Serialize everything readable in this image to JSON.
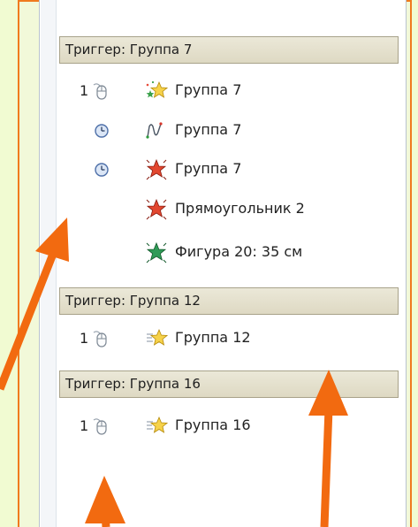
{
  "panel": {
    "triggers": [
      {
        "header": "Триггер: Группа 7",
        "items": [
          {
            "num": "1",
            "start": "mouse-click-icon",
            "effect": "entrance-effect-icon",
            "label": "Группа 7"
          },
          {
            "num": "",
            "start": "clock-icon",
            "effect": "motion-path-icon",
            "label": "Группа 7"
          },
          {
            "num": "",
            "start": "clock-icon",
            "effect": "emphasis-effect-icon",
            "label": "Группа 7"
          },
          {
            "num": "",
            "start": "",
            "effect": "emphasis-effect-icon",
            "label": "Прямоугольник 2"
          },
          {
            "num": "",
            "start": "",
            "effect": "entrance-effect-icon",
            "label": "Фигура 20: 35 см"
          }
        ]
      },
      {
        "header": "Триггер: Группа 12",
        "items": [
          {
            "num": "1",
            "start": "mouse-click-icon",
            "effect": "entrance-effect-icon",
            "label": "Группа 12"
          }
        ]
      },
      {
        "header": "Триггер: Группа 16",
        "items": [
          {
            "num": "1",
            "start": "mouse-click-icon",
            "effect": "entrance-effect-icon",
            "label": "Группа 16"
          }
        ]
      }
    ]
  },
  "colors": {
    "background": "#f1fbd2",
    "frame": "#f07a1e",
    "arrow": "#f26a10"
  }
}
